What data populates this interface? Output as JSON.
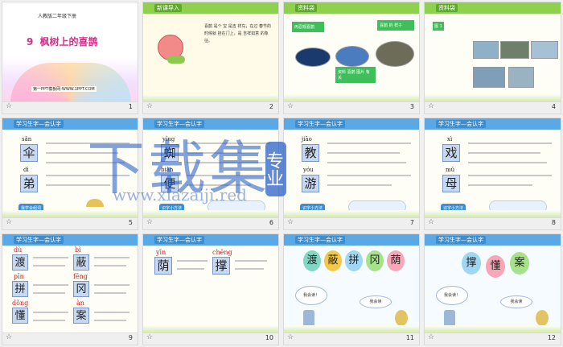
{
  "slides": [
    {
      "num": "1",
      "subtitle": "人教版二年级下册",
      "lesson_no": "9",
      "title": "枫树上的喜鹊",
      "footer_link": "第一PPT模板网-WWW.1PPT.COM"
    },
    {
      "num": "2",
      "header": "新课导入",
      "poem": "喜鹊 是个 宝 是吉 祥鸟，在过 春节的 时候就 挂在门上，是 吉祥如意 的象征。"
    },
    {
      "num": "3",
      "header": "资料袋",
      "labels": [
        "丙忍观喜鹊",
        "喜鹊 的 样子",
        "资料 喜鹊 图片 有关"
      ]
    },
    {
      "num": "4",
      "header": "资料袋",
      "label": "图 1"
    },
    {
      "num": "5",
      "header": "学习生字—会认字",
      "chars": [
        {
          "py": "sǎn",
          "ch": "伞"
        },
        {
          "py": "dì",
          "ch": "弟"
        }
      ],
      "button": "我学会组词"
    },
    {
      "num": "6",
      "header": "学习生字—会认字",
      "chars": [
        {
          "py": "yíng",
          "ch": "蜘"
        },
        {
          "py": "biàn",
          "ch": "便"
        }
      ],
      "button": "识字小方法"
    },
    {
      "num": "7",
      "header": "学习生字—会认字",
      "chars": [
        {
          "py": "jiāo",
          "ch": "教"
        },
        {
          "py": "yóu",
          "ch": "游"
        }
      ],
      "button": "识字小方法"
    },
    {
      "num": "8",
      "header": "学习生字—会认字",
      "chars": [
        {
          "py": "xì",
          "ch": "戏"
        },
        {
          "py": "mǔ",
          "ch": "母"
        }
      ],
      "button": "识字小方法"
    },
    {
      "num": "9",
      "header": "学习生字—会认字",
      "chars": [
        {
          "py": "dù",
          "ch": "渡"
        },
        {
          "py": "bì",
          "ch": "蔽"
        },
        {
          "py": "pīn",
          "ch": "拼"
        },
        {
          "py": "fēng",
          "ch": "冈"
        },
        {
          "py": "dǒng",
          "ch": "懂"
        },
        {
          "py": "àn",
          "ch": "案"
        }
      ]
    },
    {
      "num": "10",
      "header": "学习生字—会认字",
      "chars": [
        {
          "py": "yīn",
          "ch": "荫"
        },
        {
          "py": "chēng",
          "ch": "撑"
        }
      ]
    },
    {
      "num": "11",
      "header": "学习生字—会认字",
      "balloons": [
        "渡",
        "蔽",
        "拼",
        "冈",
        "荫"
      ],
      "bubbles": [
        "我会读！",
        "我会读"
      ]
    },
    {
      "num": "12",
      "header": "学习生字—会认字",
      "balloons": [
        "撑",
        "懂",
        "案"
      ],
      "bubbles": [
        "我会读！",
        "我会读"
      ]
    }
  ],
  "watermark": {
    "line1": "下载集",
    "line2": "专业",
    "url": "www.xiazaiji.red"
  },
  "colors": {
    "accent_blue": "#5aa8e6",
    "header_green": "#7ccb3c",
    "card_blue": "#c7d9f2",
    "watermark_blue": "#1f58c4"
  }
}
